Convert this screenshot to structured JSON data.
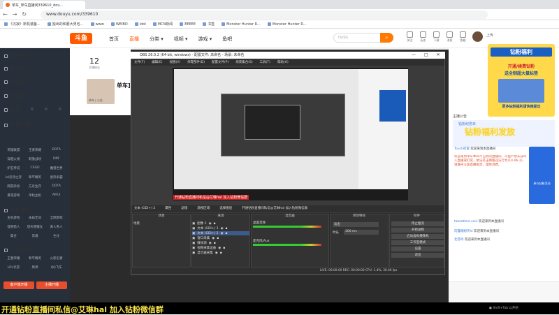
{
  "browser": {
    "tab_title": "单车_单车直播间339610_dou...",
    "url": "www.douyu.com/339610",
    "bookmarks": [
      "《沉寂》新机装备...",
      "独出的和蘑大男包...",
      "www",
      "WEIBO",
      "idol",
      "MCN新闻",
      "EEEEE",
      "书签",
      "Monster Hunter R...",
      "Monster Hunter R..."
    ]
  },
  "site": {
    "logo": "斗鱼",
    "nav": [
      "首页",
      "直播",
      "分类",
      "视频",
      "游戏",
      "鱼吧"
    ],
    "search_placeholder": "OuSG",
    "header_icons": [
      "关注",
      "历史",
      "下载",
      "消息",
      "鱼翅"
    ],
    "upload": "上传"
  },
  "sidebar": {
    "items": [
      "我的关注",
      "排行榜",
      "页游中心",
      "云游戏",
      "赛事",
      "常用分类"
    ],
    "grid_rows": [
      [
        "英雄联盟",
        "王者荣耀",
        "DOTA"
      ],
      [
        "穿越火线",
        "刺激战场",
        "DNF"
      ],
      [
        "炉石传说",
        "CSGO",
        "魔兽世界"
      ],
      [
        "lol云顶之弈",
        "和平精英",
        "星际争霸"
      ],
      [
        "网游杂谈",
        "方舟生存",
        "DOTA"
      ],
      [
        "暴雪游戏",
        "单机主机",
        "APEX"
      ]
    ],
    "section_single": "单机游戏",
    "grid_rows_2": [
      [
        "主机游戏",
        "永劫无间",
        "全网游戏"
      ],
      [
        "怪物猎人",
        "猎天使魔女",
        "真人秀人"
      ],
      [
        "集合",
        "黑魂",
        "生化"
      ]
    ],
    "section_mobile": "手游休闲",
    "grid_rows_3": [
      [
        "王者荣耀",
        "和平精英",
        "火影忍者"
      ],
      [
        "LOL手游",
        "原神",
        "QQ飞车"
      ]
    ],
    "btn_left": "客户端开播",
    "btn_right": "主播开播"
  },
  "room": {
    "fans_count": "12",
    "fans_label": "主播粉丝",
    "streamer_name": "单车]",
    "streamer_sub": "单车 | 公告"
  },
  "obs": {
    "title": "OBS 26.0.2 (64-bit, windows) - 配置文件: 未命名 - 场景: 未命名",
    "menu": [
      "文件(F)",
      "编辑(E)",
      "视图(V)",
      "停靠部件(D)",
      "配置文件(P)",
      "场景集合(S)",
      "工具(T)",
      "帮助(H)"
    ],
    "overlay_caption": "开通钻粉直播间私信@艾琳hal 加入钻粉微信群",
    "controls_bar": [
      "文本 (GDI+) 2",
      "属性",
      "滤镜",
      "源视区域",
      "选择图层",
      "开通钻粉直播间私信@艾琳hal 加入钻粉微信群"
    ],
    "dock_titles": [
      "场景",
      "来源",
      "混音器",
      "转场特效",
      "控件"
    ],
    "scene": "场景",
    "sources": [
      "图像 2",
      "文本 (GDI+) 3",
      "文本 (GDI+) 2",
      "窗口采集",
      "媒体源",
      "视频采集设备",
      "显示器采集"
    ],
    "mixer": [
      "桌面音频",
      "麦克风/Aux"
    ],
    "transition": {
      "name": "淡出",
      "duration_label": "时长",
      "duration": "300 ms"
    },
    "controls": [
      "停止推流",
      "开始录制",
      "启动虚拟摄像机",
      "工作室模式",
      "设置",
      "退出"
    ],
    "status": "LIVE: 00:00:00   REC: 00:00:00   CPU: 1.4%, 30.00 fps"
  },
  "right": {
    "ad_title": "钻粉福利",
    "ad_line1": "开通/续费钻粉",
    "ad_line2": "送全制超大鼠标垫",
    "ad_footer": "更多钻粉福利请快搜提出",
    "tab_label": "主播公告",
    "chat_header": "钻粉纪念日",
    "big_text": "钻粉福利发放",
    "ad2_text": "参与钻粉活动",
    "chat": [
      {
        "user": "Touch的雷",
        "text": "欢迎来到本直播间"
      },
      {
        "user": "",
        "text": "欢迎来到单车本间不已到的直播间，斗鱼严禁未成年人直播或打赏，依法打击网络违法行为(14-06-2)，请遵守斗鱼直播规定，理性消费。"
      },
      {
        "user": "takeatime.coin",
        "text": "欢迎来到本直播间"
      },
      {
        "user": "向露潮想天hi",
        "text": "欢迎来到本直播间"
      },
      {
        "user": "北苍鸣",
        "text": "欢迎来到本直播间"
      }
    ]
  },
  "bottom": {
    "caption": "开通钻粉直播间私信@艾琳hal 加入钻粉微信群",
    "taskbar": "● Shift+Tab 以开始"
  }
}
